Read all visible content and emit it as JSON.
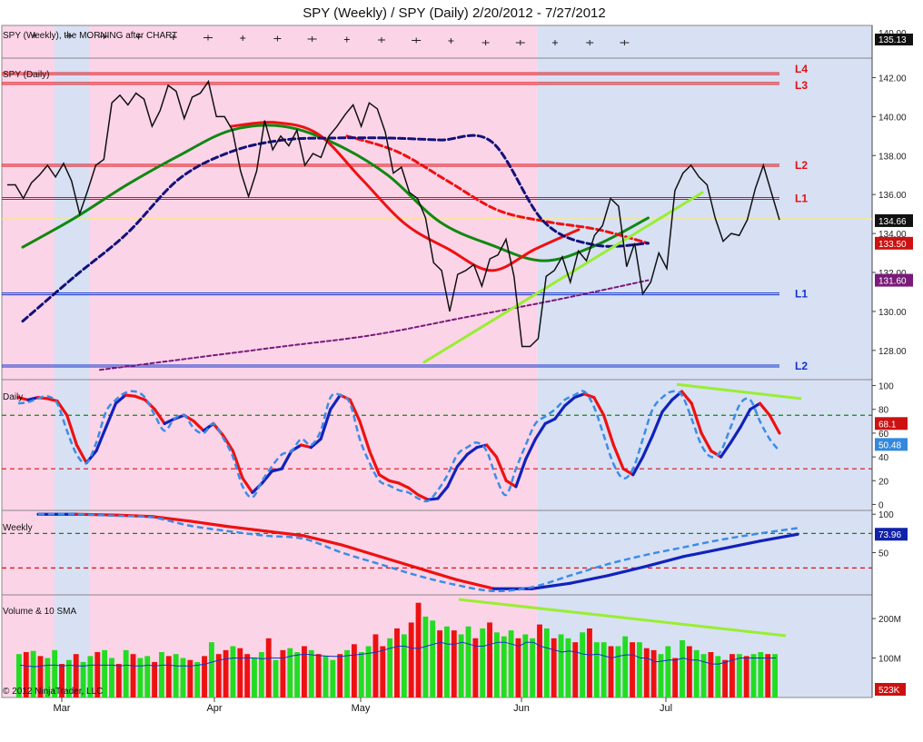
{
  "title": "SPY (Weekly) / SPY (Daily)  2/20/2012 - 7/27/2012",
  "footer": "© 2012 NinjaTrader, LLC",
  "colors": {
    "bull": "#22dd22",
    "bear": "#ee1111",
    "trend": "#99ee33",
    "shade_pink": "#fcd4e8",
    "shade_blue": "#d8e0f4"
  },
  "chart_data": [
    {
      "type": "line",
      "panel": "weekly-ticks",
      "panel_label": "SPY (Weekly), the MORNING after CHART",
      "y_ticks": [
        "140.00"
      ],
      "price_badge": "135.13"
    },
    {
      "type": "line",
      "panel": "price",
      "panel_label": "SPY (Daily)",
      "ylim": [
        126.5,
        143
      ],
      "y_ticks": [
        "142.00",
        "140.00",
        "138.00",
        "136.00",
        "134.00",
        "132.00",
        "130.00",
        "128.00"
      ],
      "x_ticks": [
        "Mar",
        "Apr",
        "May",
        "Jun",
        "Jul"
      ],
      "levels": [
        {
          "label": "L4",
          "value": 142.2,
          "color": "#dd1111"
        },
        {
          "label": "L3",
          "value": 141.7,
          "color": "#dd1111"
        },
        {
          "label": "L2",
          "value": 137.5,
          "color": "#dd1111"
        },
        {
          "label": "L1",
          "value": 135.8,
          "color": "#dd1111"
        },
        {
          "label": "L1",
          "value": 130.9,
          "color": "#1133cc"
        },
        {
          "label": "L2",
          "value": 127.2,
          "color": "#1133cc"
        }
      ],
      "close": [
        136.5,
        136.5,
        135.8,
        136.6,
        137.0,
        137.5,
        136.9,
        137.6,
        136.7,
        135.0,
        136.2,
        137.5,
        137.8,
        140.7,
        141.1,
        140.6,
        141.2,
        140.9,
        139.5,
        140.3,
        141.6,
        141.3,
        139.9,
        141.0,
        141.2,
        141.8,
        140.0,
        140.0,
        139.3,
        137.2,
        135.9,
        137.2,
        139.8,
        138.3,
        139.0,
        138.5,
        139.3,
        137.5,
        138.1,
        137.9,
        139.0,
        139.5,
        140.1,
        140.6,
        139.5,
        140.7,
        140.4,
        139.2,
        137.1,
        137.4,
        136.1,
        135.8,
        134.8,
        132.5,
        132.1,
        130.0,
        131.9,
        132.1,
        132.4,
        131.3,
        132.7,
        132.9,
        133.7,
        131.8,
        128.2,
        128.2,
        128.6,
        131.8,
        132.1,
        132.8,
        131.5,
        133.1,
        132.6,
        133.9,
        134.4,
        135.8,
        135.4,
        132.3,
        133.5,
        130.9,
        131.5,
        133.0,
        132.2,
        136.2,
        137.1,
        137.5,
        136.9,
        136.5,
        134.8,
        133.6,
        134.0,
        133.9,
        134.7,
        136.3,
        137.5,
        136.1,
        134.7
      ],
      "badges": [
        {
          "label": "134.66",
          "value": 134.66,
          "color": "#111111"
        },
        {
          "label": "133.50",
          "value": 133.5,
          "color": "#cc1111"
        },
        {
          "label": "131.60",
          "value": 131.6,
          "color": "#7a1a7a"
        }
      ],
      "series": [
        {
          "style": "solid-green",
          "start": 0.02,
          "end": 0.83,
          "values": [
            133.3,
            134.8,
            136.5,
            138.0,
            139.3,
            139.5,
            138.6,
            137.0,
            134.6,
            133.4,
            132.6,
            133.4,
            134.8
          ]
        },
        {
          "style": "solid-red",
          "start": 0.29,
          "end": 0.74,
          "values": [
            139.5,
            139.7,
            139.1,
            136.8,
            134.5,
            133.2,
            132.1,
            133.2,
            134.2
          ]
        },
        {
          "style": "dashed-red",
          "start": 0.44,
          "end": 0.83,
          "values": [
            139.0,
            138.2,
            136.7,
            135.2,
            134.6,
            134.2,
            133.5
          ]
        },
        {
          "style": "dashed-navy",
          "start": 0.02,
          "end": 0.83,
          "values": [
            129.5,
            131.8,
            134.0,
            136.8,
            138.2,
            138.8,
            138.9,
            138.9,
            138.8,
            138.7,
            134.6,
            133.4,
            133.5
          ]
        },
        {
          "style": "dashed-purple",
          "start": 0.12,
          "end": 0.83,
          "values": [
            127.0,
            127.6,
            128.2,
            128.8,
            129.7,
            130.6,
            131.6
          ]
        },
        {
          "style": "trend-line",
          "start": 0.54,
          "end": 0.9,
          "values": [
            127.4,
            136.1
          ]
        }
      ]
    },
    {
      "type": "line",
      "panel": "daily-stoch",
      "panel_label": "Daily",
      "ylim": [
        -5,
        105
      ],
      "y_ticks": [
        "100",
        "80",
        "60",
        "40",
        "20",
        "0"
      ],
      "levels": [
        {
          "value": 75,
          "color": "#118811"
        },
        {
          "value": 30,
          "color": "#dd1111"
        }
      ],
      "series": [
        {
          "name": "",
          "style": "solid-k",
          "values": [
            90,
            88,
            90,
            89,
            87,
            75,
            50,
            35,
            45,
            65,
            85,
            92,
            91,
            88,
            80,
            68,
            72,
            75,
            70,
            62,
            68,
            58,
            45,
            22,
            10,
            18,
            28,
            30,
            45,
            50,
            48,
            55,
            80,
            92,
            88,
            70,
            45,
            25,
            20,
            18,
            14,
            8,
            4,
            5,
            15,
            32,
            42,
            48,
            50,
            40,
            20,
            15,
            38,
            55,
            68,
            72,
            83,
            90,
            93,
            90,
            75,
            50,
            30,
            25,
            40,
            58,
            78,
            88,
            95,
            85,
            60,
            45,
            40,
            52,
            65,
            80,
            85,
            75,
            60
          ]
        },
        {
          "name": "",
          "style": "dashed-d",
          "values": [
            85,
            86,
            89,
            91,
            85,
            62,
            42,
            35,
            52,
            78,
            88,
            94,
            95,
            90,
            75,
            62,
            72,
            75,
            64,
            60,
            68,
            56,
            40,
            15,
            6,
            20,
            32,
            42,
            45,
            55,
            50,
            62,
            90,
            92,
            85,
            55,
            35,
            20,
            16,
            12,
            10,
            5,
            3,
            12,
            25,
            42,
            48,
            52,
            45,
            22,
            8,
            30,
            50,
            68,
            74,
            80,
            88,
            92,
            95,
            82,
            58,
            34,
            22,
            30,
            55,
            80,
            90,
            95,
            92,
            72,
            50,
            40,
            45,
            65,
            85,
            88,
            70,
            55,
            45
          ]
        }
      ],
      "badges": [
        {
          "label": "68.1",
          "value": 68.1,
          "color": "#cc1111"
        },
        {
          "label": "50.48",
          "value": 50.48,
          "color": "#3388dd"
        }
      ]
    },
    {
      "type": "line",
      "panel": "weekly-stoch",
      "panel_label": "Weekly",
      "ylim": [
        -5,
        105
      ],
      "y_ticks": [
        "100",
        "50"
      ],
      "levels": [
        {
          "value": 75,
          "color": "#118811"
        },
        {
          "value": 30,
          "color": "#dd1111"
        }
      ],
      "series": [
        {
          "name": "",
          "style": "solid-k",
          "values": [
            100,
            100,
            99,
            97,
            91,
            84,
            78,
            72,
            60,
            45,
            30,
            15,
            3,
            3,
            10,
            20,
            32,
            45,
            55,
            65,
            73.96
          ]
        },
        {
          "name": "",
          "style": "dashed-d",
          "values": [
            100,
            100,
            98,
            96,
            85,
            78,
            72,
            68,
            50,
            35,
            20,
            8,
            0,
            5,
            20,
            35,
            47,
            57,
            67,
            75,
            82
          ]
        }
      ],
      "badges": [
        {
          "label": "73.96",
          "value": 73.96,
          "color": "#1122aa"
        }
      ]
    },
    {
      "type": "bar",
      "panel": "volume",
      "panel_label": "Volume & 10 SMA",
      "ylim": [
        0,
        260
      ],
      "y_ticks": [
        "200M",
        "100M"
      ],
      "volume": [
        110,
        115,
        118,
        105,
        100,
        120,
        85,
        95,
        110,
        90,
        105,
        115,
        120,
        100,
        85,
        120,
        110,
        100,
        105,
        90,
        115,
        105,
        110,
        100,
        95,
        90,
        105,
        140,
        110,
        120,
        130,
        125,
        110,
        100,
        115,
        150,
        95,
        120,
        125,
        115,
        130,
        120,
        110,
        105,
        95,
        110,
        120,
        135,
        115,
        130,
        160,
        130,
        150,
        175,
        160,
        190,
        240,
        205,
        195,
        170,
        180,
        170,
        160,
        180,
        150,
        175,
        190,
        165,
        155,
        170,
        150,
        160,
        150,
        185,
        175,
        150,
        160,
        150,
        140,
        165,
        175,
        140,
        140,
        130,
        130,
        155,
        140,
        140,
        125,
        120,
        110,
        130,
        100,
        145,
        130,
        120,
        110,
        115,
        105,
        95,
        110,
        110,
        105,
        110,
        115,
        110,
        110
      ],
      "bull": [
        1,
        0,
        1,
        0,
        1,
        1,
        0,
        1,
        0,
        1,
        1,
        0,
        1,
        1,
        0,
        1,
        0,
        1,
        1,
        0,
        1,
        0,
        1,
        1,
        0,
        1,
        0,
        1,
        0,
        0,
        1,
        0,
        0,
        1,
        1,
        0,
        1,
        0,
        1,
        1,
        0,
        1,
        0,
        1,
        1,
        0,
        1,
        0,
        1,
        1,
        0,
        0,
        1,
        0,
        1,
        0,
        0,
        1,
        1,
        0,
        1,
        0,
        1,
        1,
        0,
        1,
        0,
        1,
        1,
        1,
        0,
        1,
        1,
        0,
        1,
        0,
        1,
        1,
        0,
        1,
        0,
        1,
        1,
        0,
        1,
        1,
        0,
        1,
        0,
        0,
        1,
        1,
        0,
        1,
        0,
        1,
        1,
        0,
        1,
        0,
        0,
        1,
        0,
        1,
        1,
        0,
        1
      ],
      "sma": [
        82,
        80,
        78,
        80,
        82,
        82,
        80,
        82,
        80,
        80,
        82,
        82,
        82,
        82,
        80,
        82,
        80,
        80,
        82,
        80,
        82,
        82,
        80,
        80,
        80,
        82,
        85,
        90,
        95,
        98,
        100,
        100,
        100,
        100,
        98,
        100,
        100,
        100,
        105,
        108,
        110,
        108,
        106,
        105,
        104,
        104,
        106,
        108,
        110,
        112,
        115,
        120,
        125,
        130,
        130,
        125,
        125,
        130,
        135,
        140,
        135,
        135,
        140,
        135,
        130,
        130,
        135,
        140,
        140,
        135,
        130,
        140,
        140,
        130,
        125,
        120,
        115,
        118,
        115,
        110,
        108,
        110,
        105,
        100,
        105,
        108,
        108,
        100,
        100,
        90,
        92,
        95,
        95,
        100,
        95,
        95,
        90,
        85,
        85,
        90,
        95,
        100,
        100,
        100,
        100,
        100,
        100
      ],
      "badges": [
        {
          "label": "523K",
          "value": 0,
          "color": "#cc1111"
        }
      ]
    }
  ]
}
